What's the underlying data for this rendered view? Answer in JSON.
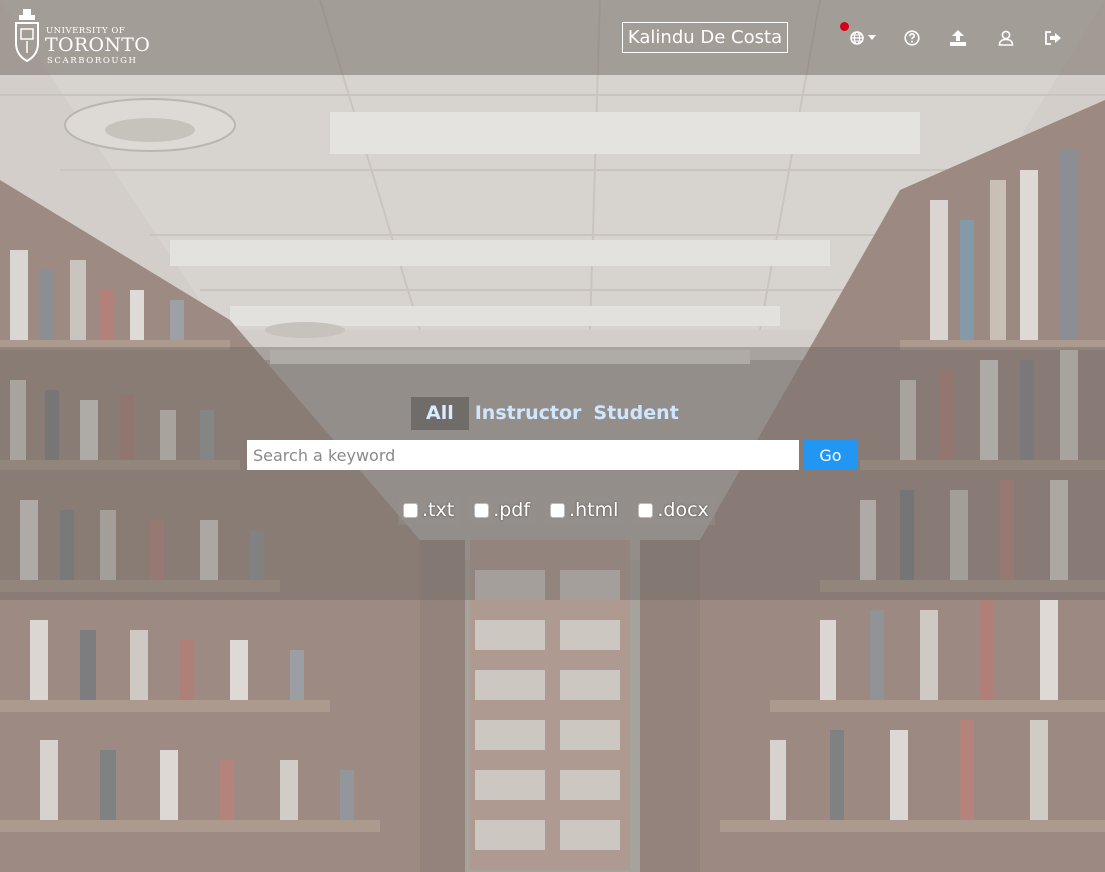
{
  "brand": {
    "line1": "UNIVERSITY OF",
    "line2": "TORONTO",
    "line3": "SCARBOROUGH"
  },
  "header": {
    "user_name": "Kalindu De Costa",
    "icons": [
      "globe-icon",
      "help-icon",
      "upload-icon",
      "user-icon",
      "sign-out-icon"
    ],
    "notification_color": "#d0021b"
  },
  "search": {
    "tabs": [
      {
        "label": "All",
        "active": true
      },
      {
        "label": "Instructor",
        "active": false
      },
      {
        "label": "Student",
        "active": false
      }
    ],
    "placeholder": "Search a keyword",
    "value": "",
    "go_label": "Go",
    "go_color": "#2196f3",
    "filters": [
      {
        "label": ".txt",
        "checked": false
      },
      {
        "label": ".pdf",
        "checked": false
      },
      {
        "label": ".html",
        "checked": false
      },
      {
        "label": ".docx",
        "checked": false
      }
    ]
  }
}
